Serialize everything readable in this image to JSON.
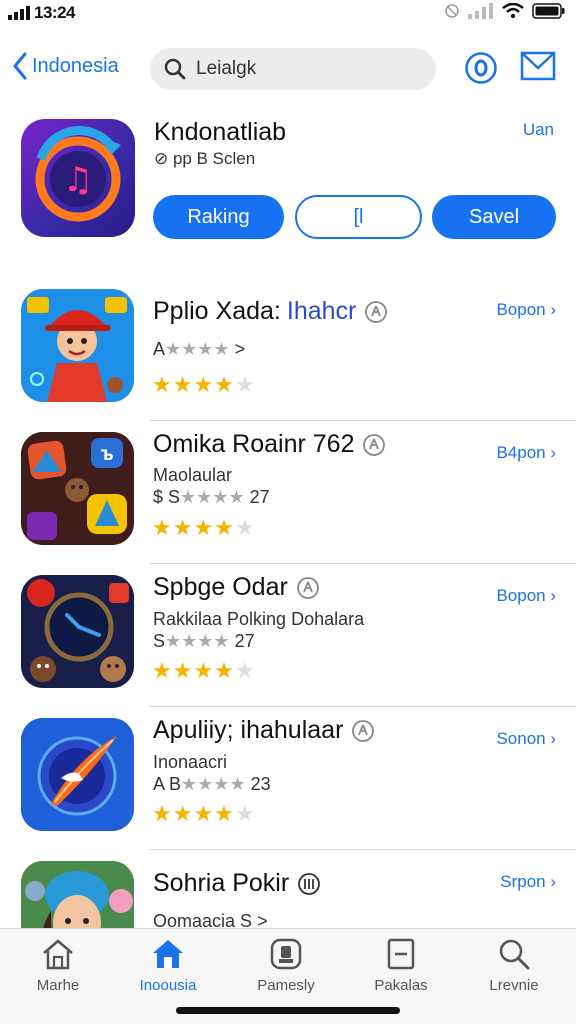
{
  "status_bar": {
    "time": "13:24"
  },
  "nav": {
    "back_label": "Indonesia",
    "search_placeholder": "Leialgk"
  },
  "featured": {
    "title": "Kndonatliab",
    "subtitle": "⊘ pp B Sclen",
    "corner_link": "Uan",
    "buttons": {
      "primary": "Raking",
      "secondary": "[Ɩ",
      "tertiary": "Savel"
    }
  },
  "apps": [
    {
      "name": "Pplio Xada:",
      "name_accent": "Ihahcr",
      "sub1": "",
      "sub2_prefix": "A",
      "sub2_stars": "★★★★",
      "sub2_suffix": ">",
      "rating": 4,
      "action": "Bopon ›",
      "colors": {
        "bg": "#1e8fe6",
        "accent": "#d8261d"
      }
    },
    {
      "name": "Omika Roainr 762",
      "name_accent": "",
      "sub1": "Maolaular",
      "sub2_prefix": "$ S",
      "sub2_stars": "★★★★",
      "sub2_suffix": "27",
      "rating": 4,
      "action": "B4pon ›",
      "colors": {
        "bg": "#3a1e1a",
        "accent": "#2a6fd6"
      }
    },
    {
      "name": "Spbge Odar",
      "name_accent": "",
      "sub1": "Rakkilaa Polking Dohalara",
      "sub2_prefix": "S",
      "sub2_stars": "★★★★",
      "sub2_suffix": "27",
      "rating": 4,
      "action": "Bopon ›",
      "colors": {
        "bg": "#1a1f4a",
        "accent": "#e23a2a"
      }
    },
    {
      "name": "Apuliiy; ihahulaar",
      "name_accent": "",
      "sub1": "Inonaacri",
      "sub2_prefix": "A B",
      "sub2_stars": "★★★★",
      "sub2_suffix": "23",
      "rating": 4,
      "action": "Sonon ›",
      "colors": {
        "bg": "#1c5fd6",
        "accent": "#ff6a1a"
      }
    },
    {
      "name": "Sohria Pokir",
      "name_accent": "",
      "sub1": "Oomaacia S",
      "sub2_prefix": "",
      "sub2_stars": "",
      "sub2_suffix": ">",
      "rating": 0,
      "action": "Srpon ›",
      "colors": {
        "bg": "#3a7a3a",
        "accent": "#2a9ad6"
      }
    }
  ],
  "tabs": [
    {
      "label": "Marhe",
      "icon": "home-outline-icon",
      "active": false
    },
    {
      "label": "Inoousia",
      "icon": "home-filled-icon",
      "active": true
    },
    {
      "label": "Pamesly",
      "icon": "gamepad-icon",
      "active": false
    },
    {
      "label": "Pakalas",
      "icon": "package-icon",
      "active": false
    },
    {
      "label": "Lrevnie",
      "icon": "search-icon",
      "active": false
    }
  ],
  "colors": {
    "accent": "#1672f0",
    "star": "#f5b400"
  }
}
